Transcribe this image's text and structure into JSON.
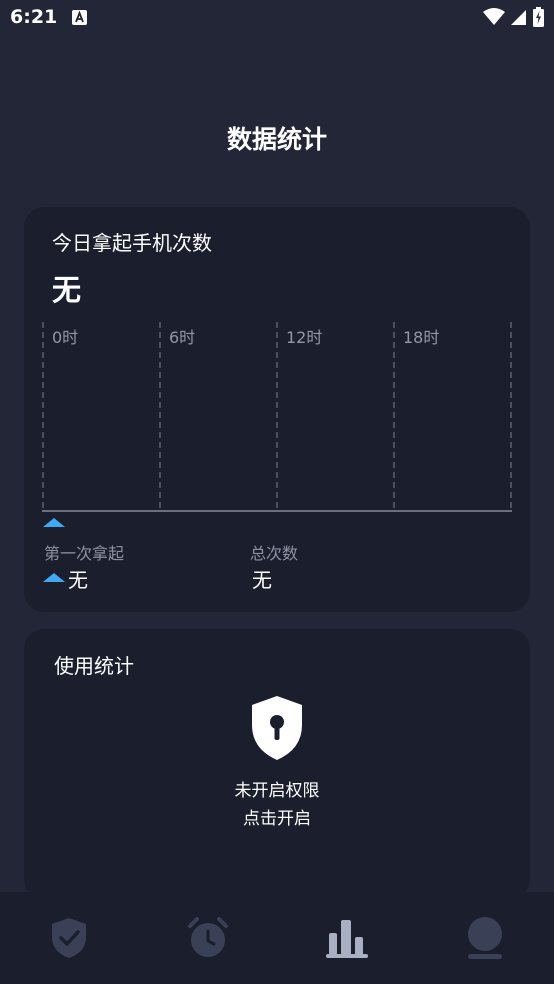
{
  "status_bar": {
    "time": "6:21"
  },
  "header": {
    "title": "数据统计"
  },
  "today_card": {
    "title": "今日拿起手机次数",
    "count": "无",
    "hour_labels": [
      "0时",
      "6时",
      "12时",
      "18时"
    ],
    "first_pickup": {
      "label": "第一次拿起",
      "value": "无"
    },
    "total": {
      "label": "总次数",
      "value": "无"
    },
    "accent_color": "#3fa9f5"
  },
  "usage_card": {
    "title": "使用统计",
    "permission_status": "未开启权限",
    "permission_action": "点击开启",
    "icon": "lock-shield-icon"
  },
  "bottom_nav": {
    "items": [
      {
        "icon": "shield-check-icon",
        "active": false
      },
      {
        "icon": "alarm-clock-icon",
        "active": false
      },
      {
        "icon": "bar-chart-icon",
        "active": true
      },
      {
        "icon": "profile-icon",
        "active": false
      }
    ],
    "active_color": "#a9b0c4",
    "inactive_color": "#3a4056"
  }
}
